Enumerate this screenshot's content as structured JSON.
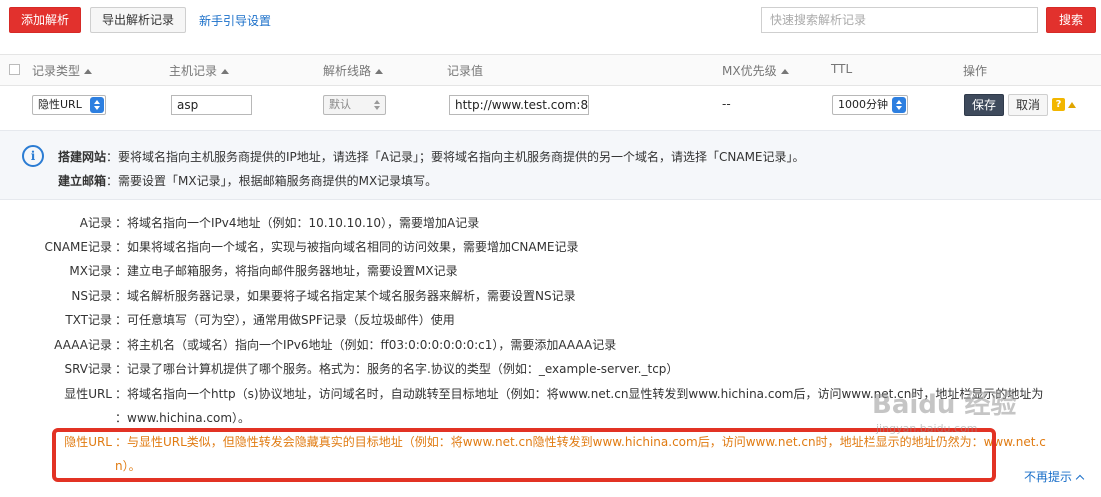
{
  "toolbar": {
    "add_label": "添加解析",
    "export_label": "导出解析记录",
    "guide_label": "新手引导设置",
    "search_placeholder": "快速搜索解析记录",
    "search_label": "搜索"
  },
  "table": {
    "columns": [
      "记录类型",
      "主机记录",
      "解析线路",
      "记录值",
      "MX优先级",
      "TTL",
      "操作"
    ]
  },
  "edit_row": {
    "record_type": "隐性URL",
    "host": "asp",
    "line": "默认",
    "value": "http://www.test.com:8",
    "mx": "--",
    "ttl": "1000分钟",
    "save_label": "保存",
    "cancel_label": "取消",
    "help_mark": "?"
  },
  "info": {
    "line1_label": "搭建网站",
    "line1_text": "：要将域名指向主机服务商提供的IP地址，请选择「A记录」；要将域名指向主机服务商提供的另一个域名，请选择「CNAME记录」。",
    "line2_label": "建立邮箱",
    "line2_text": "：需要设置「MX记录」，根据邮箱服务商提供的MX记录填写。"
  },
  "help": [
    {
      "label": "A记录",
      "text": "：将域名指向一个IPv4地址（例如：10.10.10.10），需要增加A记录"
    },
    {
      "label": "CNAME记录",
      "text": "：如果将域名指向一个域名，实现与被指向域名相同的访问效果，需要增加CNAME记录"
    },
    {
      "label": "MX记录",
      "text": "：建立电子邮箱服务，将指向邮件服务器地址，需要设置MX记录"
    },
    {
      "label": "NS记录",
      "text": "：域名解析服务器记录，如果要将子域名指定某个域名服务器来解析，需要设置NS记录"
    },
    {
      "label": "TXT记录",
      "text": "：可任意填写（可为空），通常用做SPF记录（反垃圾邮件）使用"
    },
    {
      "label": "AAAA记录",
      "text": "：将主机名（或域名）指向一个IPv6地址（例如：ff03:0:0:0:0:0:0:c1），需要添加AAAA记录"
    },
    {
      "label": "SRV记录",
      "text": "：记录了哪台计算机提供了哪个服务。格式为：服务的名字.协议的类型（例如：_example-server._tcp）"
    },
    {
      "label": "显性URL",
      "text": "：将域名指向一个http（s)协议地址，访问域名时，自动跳转至目标地址（例如：将www.net.cn显性转发到www.hichina.com后，访问www.net.cn时，地址栏显示的地址为"
    },
    {
      "label": "",
      "text": "：www.hichina.com）。"
    },
    {
      "label": "隐性URL",
      "text": "：与显性URL类似，但隐性转发会隐藏真实的目标地址（例如：将www.net.cn隐性转发到www.hichina.com后，访问www.net.cn时，地址栏显示的地址仍然为：www.net.c"
    },
    {
      "label": "",
      "text": "n）。"
    }
  ],
  "no_tip_label": "不再提示",
  "watermark": {
    "line1": "Baidu 经验",
    "line2": "jingyan.baidu.com"
  }
}
